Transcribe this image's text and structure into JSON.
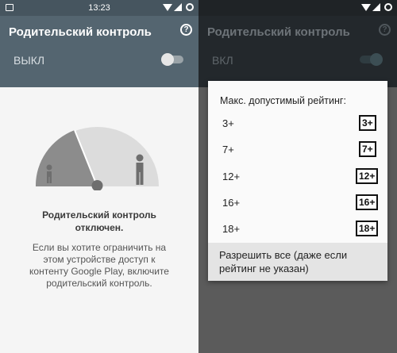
{
  "status_bar": {
    "time": "13:23"
  },
  "left": {
    "title": "Родительский контроль",
    "help_glyph": "?",
    "toggle_label": "ВЫКЛ",
    "message_title_line1": "Родительский контроль",
    "message_title_line2": "отключен.",
    "message_line1": "Если вы хотите ограничить на",
    "message_line2": "этом устройстве доступ к",
    "message_line3": "контенту Google Play, включите",
    "message_line4": "родительский контроль."
  },
  "right": {
    "title": "Родительский контроль",
    "help_glyph": "?",
    "toggle_label": "ВКЛ",
    "dialog": {
      "title": "Макс. допустимый рейтинг:",
      "options": [
        {
          "label": "3+",
          "badge": "3+"
        },
        {
          "label": "7+",
          "badge": "7+"
        },
        {
          "label": "12+",
          "badge": "12+"
        },
        {
          "label": "16+",
          "badge": "16+"
        },
        {
          "label": "18+",
          "badge": "18+"
        }
      ],
      "allow_all_line1": "Разрешить все (даже если",
      "allow_all_line2": "рейтинг не указан)"
    }
  },
  "colors": {
    "left_appbar": "#546570",
    "right_appbar": "#23282c",
    "gauge_light": "#dcdcdc",
    "gauge_dark": "#8c8c8c"
  },
  "icons": [
    "image-icon",
    "wifi-icon",
    "signal-icon",
    "circle-status-icon",
    "help-icon",
    "child-figure-icon",
    "adult-figure-icon"
  ]
}
